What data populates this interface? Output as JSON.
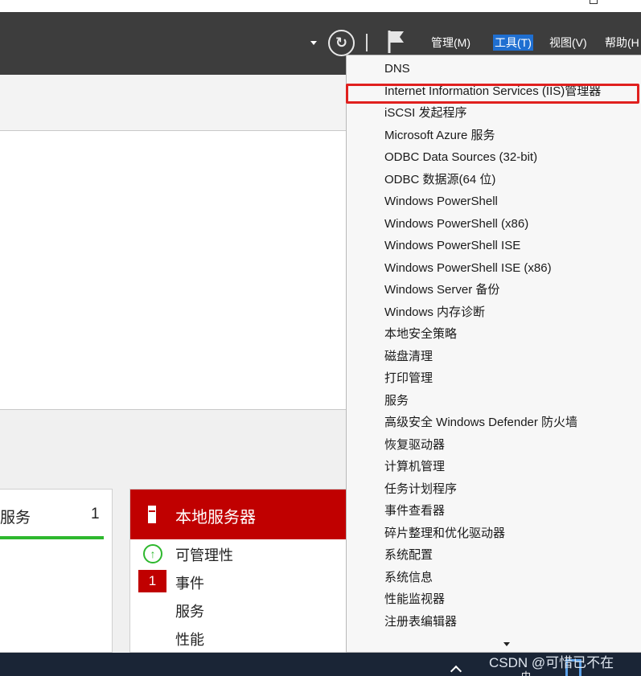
{
  "window": {
    "restore_button": "restore-icon"
  },
  "header": {
    "menus": [
      {
        "label": "管理(M)"
      },
      {
        "label": "工具(T)"
      },
      {
        "label": "视图(V)"
      },
      {
        "label": "帮助(H"
      }
    ],
    "refresh_icon_glyph": "↻"
  },
  "tools_menu": {
    "items": [
      "DNS",
      "Internet Information Services (IIS)管理器",
      "iSCSI 发起程序",
      "Microsoft Azure 服务",
      "ODBC Data Sources (32-bit)",
      "ODBC 数据源(64 位)",
      "Windows PowerShell",
      "Windows PowerShell (x86)",
      "Windows PowerShell ISE",
      "Windows PowerShell ISE (x86)",
      "Windows Server 备份",
      "Windows 内存诊断",
      "本地安全策略",
      "磁盘清理",
      "打印管理",
      "服务",
      "高级安全 Windows Defender 防火墙",
      "恢复驱动器",
      "计算机管理",
      "任务计划程序",
      "事件查看器",
      "碎片整理和优化驱动器",
      "系统配置",
      "系统信息",
      "性能监视器",
      "注册表编辑器"
    ],
    "highlighted_item": "Internet Information Services (IIS)管理器"
  },
  "tiles": {
    "left_tile": {
      "label": "服务",
      "count": "1"
    },
    "local_server": {
      "title": "本地服务器",
      "rows": [
        "可管理性",
        "事件",
        "服务",
        "性能"
      ],
      "event_count": "1"
    }
  },
  "taskbar": {
    "watermark": "CSDN @可惜已不在",
    "ime": "中"
  },
  "colors": {
    "appbar": "#3d3d3d",
    "local_server_header": "#c00000",
    "ok_green": "#2eb82e",
    "active_menu": "#1f6fd1",
    "highlight_box": "#e0201e"
  }
}
